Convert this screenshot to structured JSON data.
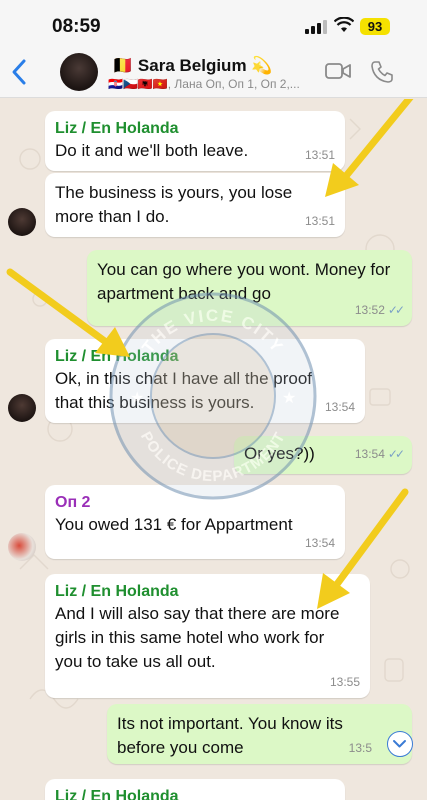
{
  "status": {
    "time": "08:59",
    "battery": "93"
  },
  "header": {
    "contact_name": "Sara Belgium",
    "name_flag": "🇧🇪",
    "name_emoji": "💫",
    "members_flags": "🇭🇷🇨🇿🇦🇱🇻🇳",
    "members": ", Лана Оп, Оп 1, Оп 2,..."
  },
  "messages": [
    {
      "side": "in",
      "sender": "Liz / En Holanda",
      "text": "Do it and we'll both leave.",
      "time": "13:51"
    },
    {
      "side": "in",
      "sender": "",
      "text": "The business is yours, you lose more than I do.",
      "time": "13:51"
    },
    {
      "side": "out",
      "text": "You can go where you wont. Money for apartment back and go",
      "time": "13:52",
      "ticks": "✓✓"
    },
    {
      "side": "in",
      "sender": "Liz / En Holanda",
      "text": "Ok, in this chat I have all the proof that this business is yours.",
      "time": "13:54"
    },
    {
      "side": "out",
      "text": "Or yes?))",
      "time": "13:54",
      "ticks": "✓✓"
    },
    {
      "side": "in",
      "sender": "Оп 2",
      "text": "You owed 131 € for Appartment",
      "time": "13:54"
    },
    {
      "side": "in",
      "sender": "Liz / En Holanda",
      "text": "And I will also say that there are more girls in this same hotel who work for you to take us all out.",
      "time": "13:55"
    },
    {
      "side": "out",
      "text": "Its not important. You know its before you come",
      "time": "13:5"
    },
    {
      "side": "in",
      "sender": "Liz / En Holanda",
      "text": "",
      "time": ""
    }
  ],
  "watermark": {
    "top_text": "THE VICE CITY",
    "bottom_text": "POLICE DEPARTMENT"
  },
  "colors": {
    "incoming": "#ffffff",
    "outgoing": "#dcf8c6",
    "sender_green": "#1f8f2f",
    "sender_purple": "#9a2fb8",
    "arrow": "#f2cc1d"
  },
  "icons": [
    "back-chevron-icon",
    "video-call-icon",
    "phone-call-icon",
    "scroll-down-icon"
  ]
}
